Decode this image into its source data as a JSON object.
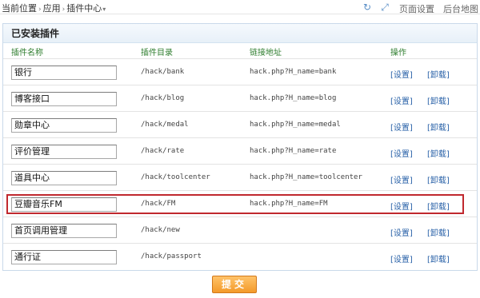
{
  "breadcrumb": {
    "items": [
      "当前位置",
      "应用",
      "插件中心"
    ]
  },
  "toolbar": {
    "refresh_icon": "refresh-icon",
    "fullscreen_icon": "fullscreen-icon",
    "page_settings": "页面设置",
    "backend_map": "后台地图"
  },
  "panel": {
    "title": "已安装插件",
    "headers": [
      "插件名称",
      "插件目录",
      "链接地址",
      "操作"
    ]
  },
  "plugins": [
    {
      "name": "银行",
      "dir": "/hack/bank",
      "url": "hack.php?H_name=bank",
      "settings": "[设置]",
      "uninstall": "[卸载]"
    },
    {
      "name": "博客接口",
      "dir": "/hack/blog",
      "url": "hack.php?H_name=blog",
      "settings": "[设置]",
      "uninstall": "[卸载]"
    },
    {
      "name": "勋章中心",
      "dir": "/hack/medal",
      "url": "hack.php?H_name=medal",
      "settings": "[设置]",
      "uninstall": "[卸载]"
    },
    {
      "name": "评价管理",
      "dir": "/hack/rate",
      "url": "hack.php?H_name=rate",
      "settings": "[设置]",
      "uninstall": "[卸载]"
    },
    {
      "name": "道具中心",
      "dir": "/hack/toolcenter",
      "url": "hack.php?H_name=toolcenter",
      "settings": "[设置]",
      "uninstall": "[卸载]"
    },
    {
      "name": "豆瓣音乐FM",
      "dir": "/hack/FM",
      "url": "hack.php?H_name=FM",
      "settings": "[设置]",
      "uninstall": "[卸载]"
    },
    {
      "name": "首页调用管理",
      "dir": "/hack/new",
      "url": "",
      "settings": "[设置]",
      "uninstall": "[卸载]"
    },
    {
      "name": "通行证",
      "dir": "/hack/passport",
      "url": "",
      "settings": "[设置]",
      "uninstall": "[卸载]"
    }
  ],
  "submit_label": "提交",
  "colors": {
    "header_green": "#2e7d2e",
    "link_blue": "#2a62a8",
    "highlight_red": "#c0282e",
    "button_orange": "#f39a2a"
  }
}
